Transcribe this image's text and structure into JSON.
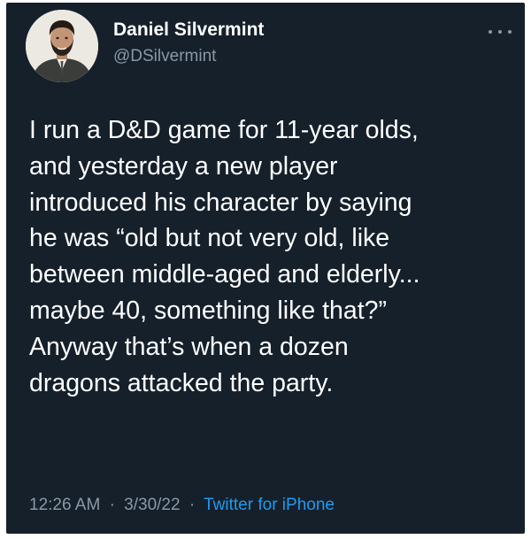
{
  "author": {
    "name": "Daniel Silvermint",
    "handle": "@DSilvermint"
  },
  "menu_icon": "more-horizontal-icon",
  "tweet": {
    "lines": [
      "I run a D&D game for 11-year olds,",
      "and yesterday a new player",
      "introduced his character by saying",
      "he was “old but not very old, like",
      "between middle-aged and elderly...",
      "maybe 40, something like that?”",
      "Anyway that’s when a dozen",
      "dragons attacked the party."
    ]
  },
  "meta": {
    "time": "12:26 AM",
    "separator": "·",
    "date": "3/30/22",
    "source": "Twitter for iPhone"
  },
  "colors": {
    "background": "#15202b",
    "text": "#ffffff",
    "secondary": "#8a99a6",
    "link": "#1d9bf0"
  }
}
